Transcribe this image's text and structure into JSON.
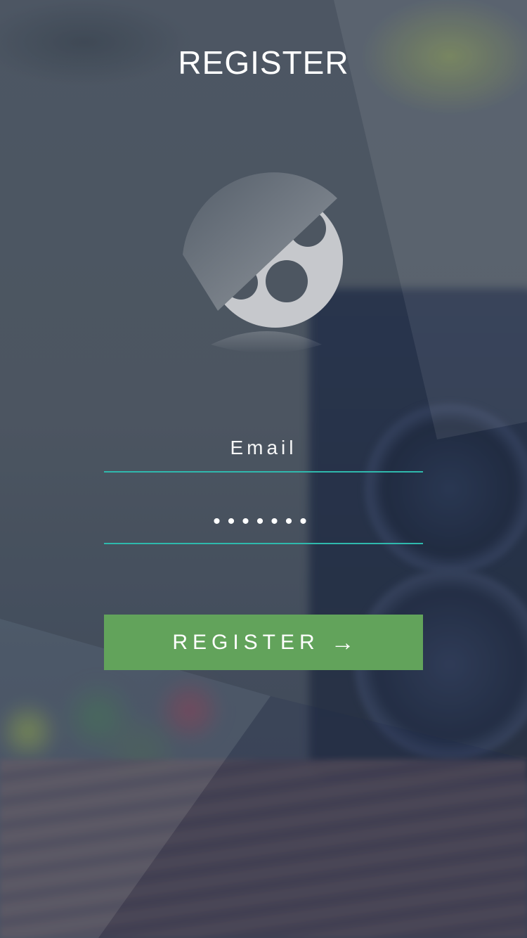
{
  "header": {
    "title": "REGISTER"
  },
  "logo": {
    "icon": "film-reel-icon"
  },
  "form": {
    "email": {
      "placeholder": "Email",
      "value": ""
    },
    "password": {
      "value": "•••••••"
    },
    "submit": {
      "label": "REGISTER",
      "icon": "arrow-right-icon",
      "arrow": "→"
    }
  },
  "colors": {
    "accent_line": "#2fb9ad",
    "button": "#62a35b",
    "text": "#ffffff"
  }
}
